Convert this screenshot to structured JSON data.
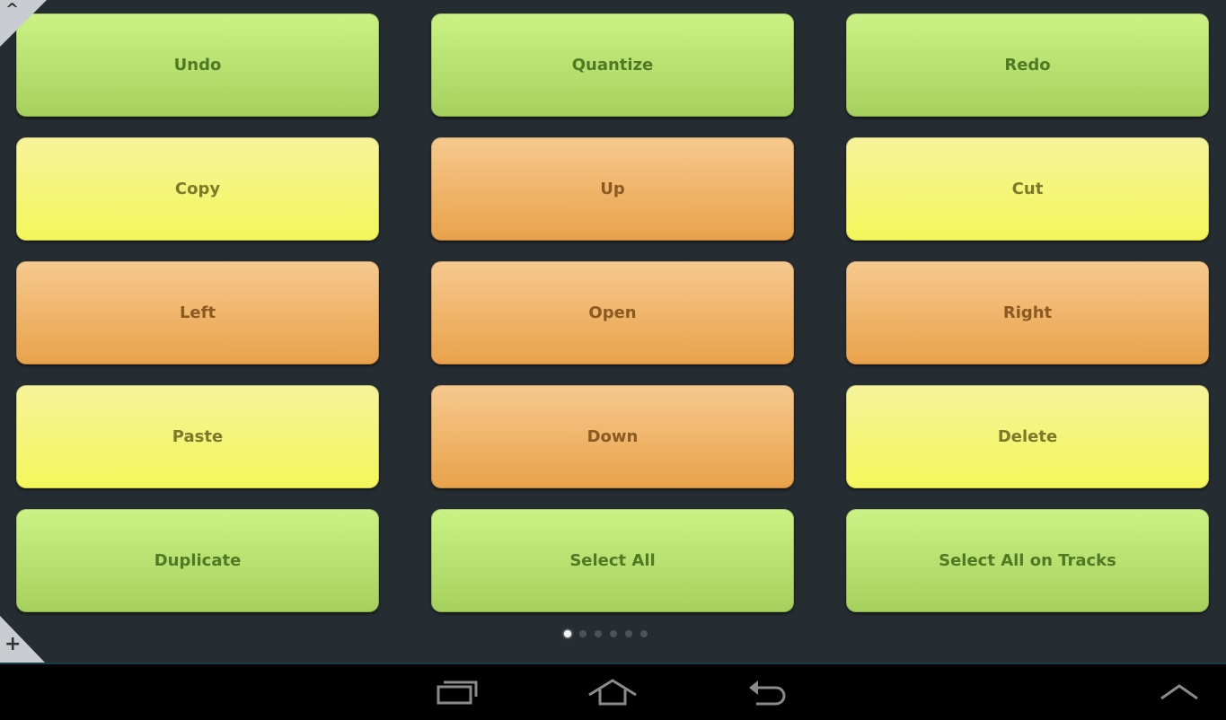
{
  "pads": [
    {
      "label": "Undo",
      "color": "green"
    },
    {
      "label": "Quantize",
      "color": "green"
    },
    {
      "label": "Redo",
      "color": "green"
    },
    {
      "label": "Copy",
      "color": "yellow"
    },
    {
      "label": "Up",
      "color": "orange"
    },
    {
      "label": "Cut",
      "color": "yellow"
    },
    {
      "label": "Left",
      "color": "orange"
    },
    {
      "label": "Open",
      "color": "orange"
    },
    {
      "label": "Right",
      "color": "orange"
    },
    {
      "label": "Paste",
      "color": "yellow"
    },
    {
      "label": "Down",
      "color": "orange"
    },
    {
      "label": "Delete",
      "color": "yellow"
    },
    {
      "label": "Duplicate",
      "color": "green"
    },
    {
      "label": "Select All",
      "color": "green"
    },
    {
      "label": "Select All on Tracks",
      "color": "green"
    }
  ],
  "corners": {
    "top_icon": "^",
    "bottom_icon": "+"
  },
  "pagination": {
    "total_pages": 6,
    "current_page": 1
  },
  "navbar": {
    "buttons": [
      "recent-apps",
      "home",
      "back",
      "menu-up"
    ]
  },
  "colors": {
    "green": "#b8e070",
    "yellow": "#f5f578",
    "orange": "#eeb36a",
    "background": "#262d32"
  }
}
